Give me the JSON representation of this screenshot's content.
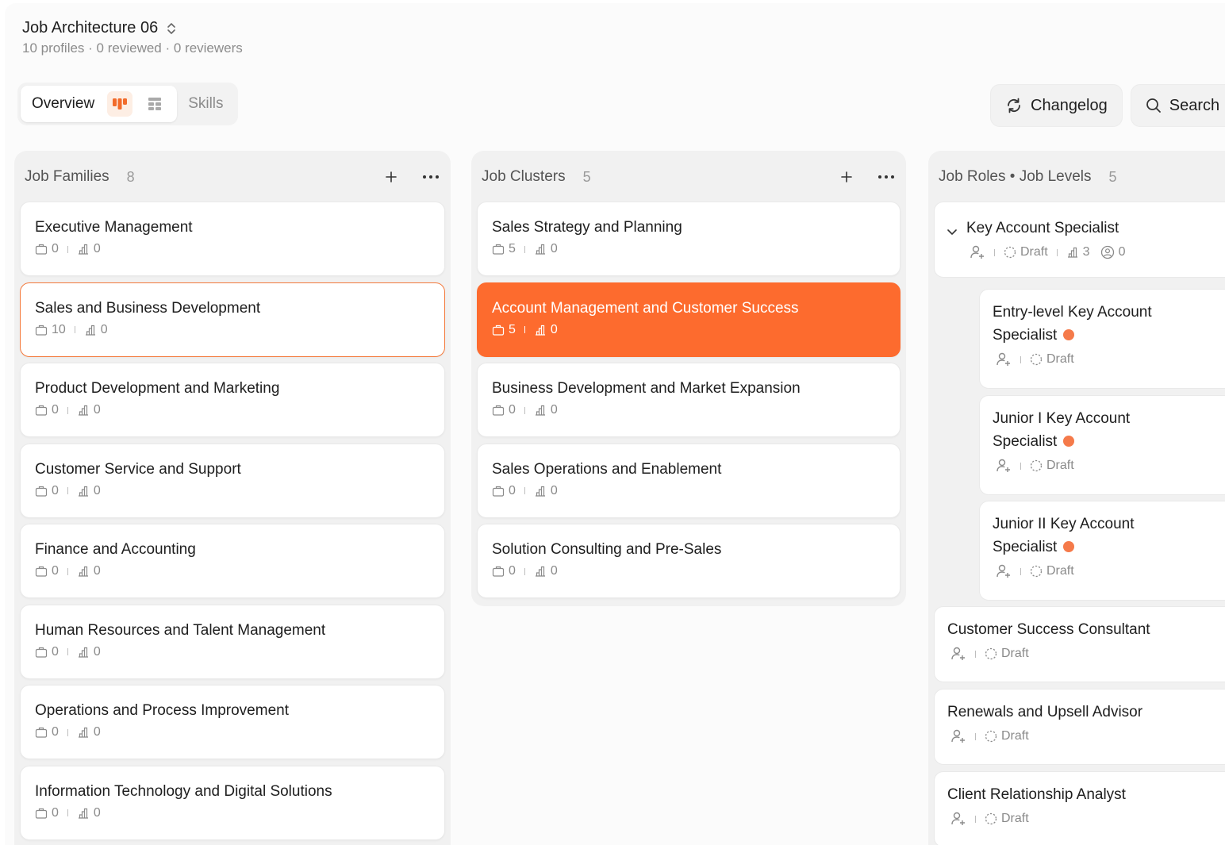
{
  "header": {
    "title": "Job Architecture 06",
    "subtitle": "10 profiles · 0 reviewed · 0 reviewers"
  },
  "tabs": {
    "overview": "Overview",
    "skills": "Skills"
  },
  "actions": {
    "changelog": "Changelog",
    "search": "Search"
  },
  "columns": {
    "families": {
      "title": "Job Families",
      "count": "8",
      "items": [
        {
          "title": "Executive Management",
          "a": "0",
          "b": "0"
        },
        {
          "title": "Sales and Business Development",
          "a": "10",
          "b": "0"
        },
        {
          "title": "Product Development and Marketing",
          "a": "0",
          "b": "0"
        },
        {
          "title": "Customer Service and Support",
          "a": "0",
          "b": "0"
        },
        {
          "title": "Finance and Accounting",
          "a": "0",
          "b": "0"
        },
        {
          "title": "Human Resources and Talent Management",
          "a": "0",
          "b": "0"
        },
        {
          "title": "Operations and Process Improvement",
          "a": "0",
          "b": "0"
        },
        {
          "title": "Information Technology and Digital Solutions",
          "a": "0",
          "b": "0"
        }
      ]
    },
    "clusters": {
      "title": "Job Clusters",
      "count": "5",
      "items": [
        {
          "title": "Sales Strategy and Planning",
          "a": "5",
          "b": "0"
        },
        {
          "title": "Account Management and Customer Success",
          "a": "5",
          "b": "0"
        },
        {
          "title": "Business Development and Market Expansion",
          "a": "0",
          "b": "0"
        },
        {
          "title": "Sales Operations and Enablement",
          "a": "0",
          "b": "0"
        },
        {
          "title": "Solution Consulting and Pre-Sales",
          "a": "0",
          "b": "0"
        }
      ]
    },
    "roles": {
      "title": "Job Roles • Job Levels",
      "count": "5",
      "parent": {
        "title": "Key Account Specialist",
        "status": "Draft",
        "levels": "3",
        "reviewers": "0"
      },
      "levels": [
        {
          "title1": "Entry-level Key Account",
          "title2": "Specialist",
          "status": "Draft"
        },
        {
          "title1": "Junior I Key Account",
          "title2": "Specialist",
          "status": "Draft"
        },
        {
          "title1": "Junior II Key Account",
          "title2": "Specialist",
          "status": "Draft"
        }
      ],
      "others": [
        {
          "title": "Customer Success Consultant",
          "status": "Draft"
        },
        {
          "title": "Renewals and Upsell Advisor",
          "status": "Draft"
        },
        {
          "title": "Client Relationship Analyst",
          "status": "Draft"
        }
      ]
    }
  },
  "colors": {
    "accent": "#fd6b2e",
    "accent_outline": "#f47a3c",
    "level_dot": "#f57a4a",
    "status_ring": "#f5dc8f"
  }
}
